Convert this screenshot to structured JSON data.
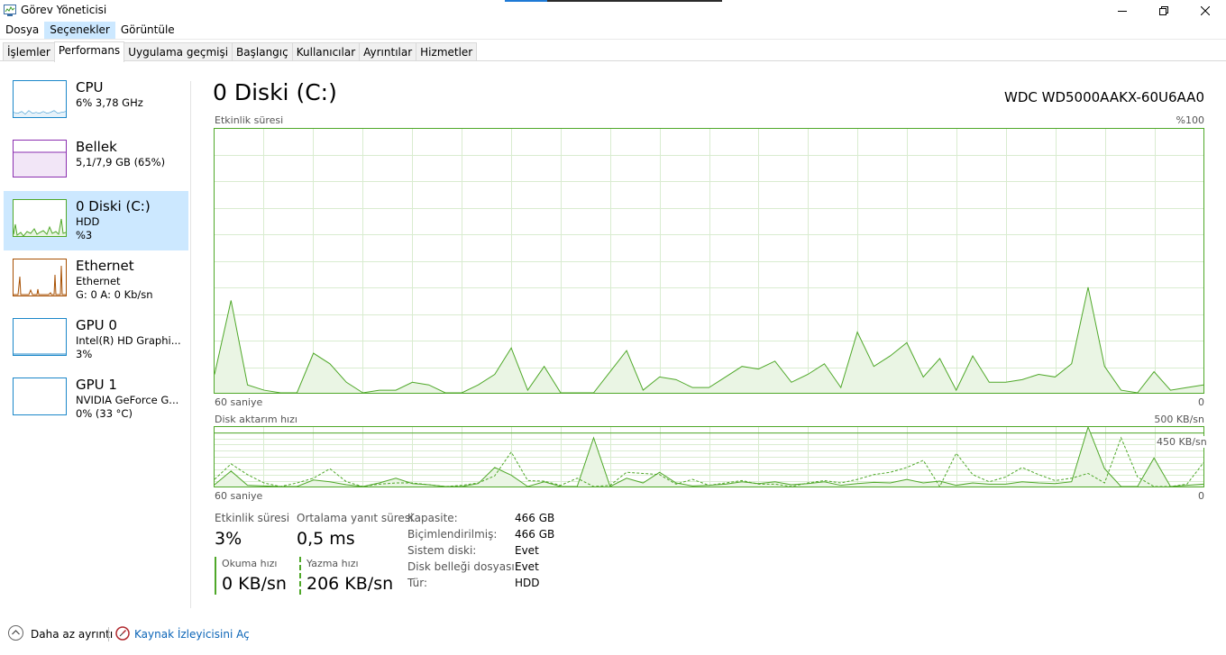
{
  "window": {
    "title": "Görev Yöneticisi"
  },
  "menu": [
    "Dosya",
    "Seçenekler",
    "Görüntüle"
  ],
  "tabs": [
    "İşlemler",
    "Performans",
    "Uygulama geçmişi",
    "Başlangıç",
    "Kullanıcılar",
    "Ayrıntılar",
    "Hizmetler"
  ],
  "sidebar": {
    "items": [
      {
        "name": "CPU",
        "line2": "6%  3,78 GHz",
        "line3": "",
        "color": "#1b87c9"
      },
      {
        "name": "Bellek",
        "line2": "5,1/7,9 GB (65%)",
        "line3": "",
        "color": "#8b2fb0"
      },
      {
        "name": "0 Diski (C:)",
        "line2": "HDD",
        "line3": "%3",
        "color": "#4fa829"
      },
      {
        "name": "Ethernet",
        "line2": "Ethernet",
        "line3": "G: 0  A: 0 Kb/sn",
        "color": "#a74f01"
      },
      {
        "name": "GPU 0",
        "line2": "Intel(R) HD Graphi...",
        "line3": "3%",
        "color": "#1b87c9"
      },
      {
        "name": "GPU 1",
        "line2": "NVIDIA GeForce G...",
        "line3": "0% (33 °C)",
        "color": "#1b87c9"
      }
    ]
  },
  "main": {
    "title": "0 Diski (C:)",
    "device": "WDC WD5000AAKX-60U6AA0",
    "active_time_chart": {
      "label": "Etkinlik süresi",
      "max_label": "%100",
      "left_bottom": "60 saniye",
      "right_bottom": "0"
    },
    "transfer_chart": {
      "label": "Disk aktarım hızı",
      "max_label": "500 KB/sn",
      "marker_label": "450 KB/sn",
      "left_bottom": "60 saniye",
      "right_bottom": "0"
    },
    "stats": {
      "active_label": "Etkinlik süresi",
      "active_value": "3%",
      "avg_label": "Ortalama yanıt süresi",
      "avg_value": "0,5 ms",
      "read_label": "Okuma hızı",
      "read_value": "0 KB/sn",
      "write_label": "Yazma hızı",
      "write_value": "206 KB/sn"
    },
    "info": [
      {
        "k": "Kapasite:",
        "v": "466 GB"
      },
      {
        "k": "Biçimlendirilmiş:",
        "v": "466 GB"
      },
      {
        "k": "Sistem diski:",
        "v": "Evet"
      },
      {
        "k": "Disk belleği dosyası:",
        "v": "Evet"
      },
      {
        "k": "Tür:",
        "v": "HDD"
      }
    ]
  },
  "footer": {
    "fewer_details": "Daha az ayrıntı",
    "resource_monitor": "Kaynak İzleyicisini Aç"
  },
  "chart_data": [
    {
      "type": "area",
      "title": "Etkinlik süresi",
      "xlabel": "60 saniye",
      "ylim": [
        0,
        100
      ],
      "x": [
        60,
        59,
        58,
        57,
        56,
        55,
        54,
        53,
        52,
        51,
        50,
        49,
        48,
        47,
        46,
        45,
        44,
        43,
        42,
        41,
        40,
        39,
        38,
        37,
        36,
        35,
        34,
        33,
        32,
        31,
        30,
        29,
        28,
        27,
        26,
        25,
        24,
        23,
        22,
        21,
        20,
        19,
        18,
        17,
        16,
        15,
        14,
        13,
        12,
        11,
        10,
        9,
        8,
        7,
        6,
        5,
        4,
        3,
        2,
        1,
        0
      ],
      "values": [
        7,
        35,
        3,
        1,
        0,
        0,
        15,
        11,
        4,
        0,
        1,
        1,
        4,
        3,
        0,
        0,
        3,
        7,
        17,
        1,
        10,
        0,
        0,
        0,
        8,
        16,
        1,
        6,
        5,
        2,
        2,
        6,
        10,
        9,
        12,
        4,
        7,
        11,
        2,
        23,
        10,
        14,
        19,
        6,
        13,
        1,
        14,
        4,
        4,
        5,
        7,
        6,
        11,
        40,
        10,
        1,
        0,
        8,
        1,
        2,
        3
      ],
      "series_color": "#4fa829"
    },
    {
      "type": "line",
      "title": "Disk aktarım hızı",
      "xlabel": "60 saniye",
      "ylim": [
        0,
        500
      ],
      "marker_value": 450,
      "x": [
        60,
        59,
        58,
        57,
        56,
        55,
        54,
        53,
        52,
        51,
        50,
        49,
        48,
        47,
        46,
        45,
        44,
        43,
        42,
        41,
        40,
        39,
        38,
        37,
        36,
        35,
        34,
        33,
        32,
        31,
        30,
        29,
        28,
        27,
        26,
        25,
        24,
        23,
        22,
        21,
        20,
        19,
        18,
        17,
        16,
        15,
        14,
        13,
        12,
        11,
        10,
        9,
        8,
        7,
        6,
        5,
        4,
        3,
        2,
        1,
        0
      ],
      "series": [
        {
          "name": "Okuma hızı",
          "style": "solid",
          "values": [
            15,
            130,
            10,
            5,
            0,
            0,
            55,
            40,
            15,
            0,
            30,
            70,
            25,
            15,
            0,
            0,
            25,
            160,
            95,
            0,
            40,
            0,
            0,
            410,
            0,
            70,
            30,
            120,
            30,
            5,
            10,
            20,
            40,
            25,
            40,
            15,
            25,
            40,
            10,
            25,
            35,
            30,
            60,
            30,
            45,
            10,
            30,
            20,
            20,
            40,
            30,
            25,
            40,
            510,
            150,
            0,
            0,
            240,
            0,
            10,
            20
          ]
        },
        {
          "name": "Yazma hızı",
          "style": "dashed",
          "values": [
            60,
            190,
            100,
            30,
            0,
            30,
            70,
            150,
            40,
            0,
            20,
            30,
            30,
            15,
            0,
            10,
            30,
            90,
            290,
            50,
            45,
            10,
            70,
            0,
            10,
            120,
            110,
            100,
            20,
            60,
            10,
            30,
            50,
            20,
            20,
            0,
            30,
            50,
            30,
            60,
            100,
            120,
            160,
            220,
            0,
            280,
            100,
            40,
            80,
            160,
            100,
            50,
            70,
            110,
            30,
            410,
            80,
            0,
            0,
            20,
            200
          ]
        }
      ]
    }
  ]
}
